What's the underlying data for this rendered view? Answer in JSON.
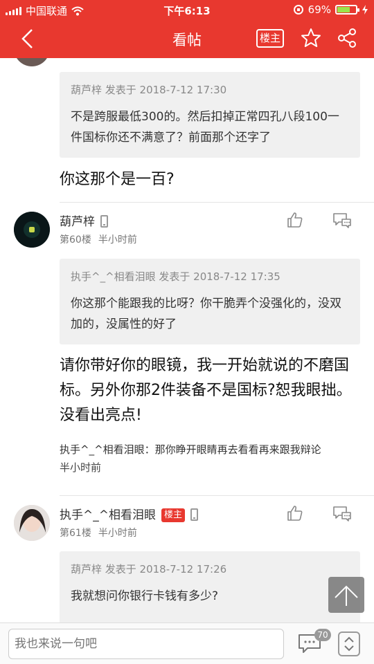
{
  "status_bar": {
    "carrier": "中国联通",
    "time": "下午6:13",
    "battery_percent": "69%",
    "battery_level": 0.69
  },
  "nav": {
    "title": "看帖",
    "owner_label": "楼主"
  },
  "posts": [
    {
      "quote_head": "葫芦梓 发表于 2018-7-12 17:30",
      "quote_body": "不是跨服最低300的。然后扣掉正常四孔八段100一件国标你还不满意了？前面那个还字了",
      "reply": "你这那个是一百?"
    },
    {
      "username": "葫芦梓",
      "floor": "第60楼",
      "time": "半小时前",
      "quote_head": "执手^_^相看泪眼 发表于 2018-7-12 17:35",
      "quote_body": "你这那个能跟我的比呀？你干脆弄个没强化的，没双加的，没属性的好了",
      "reply": "请你带好你的眼镜，我一开始就说的不磨国标。另外你那2件装备不是国标?恕我眼拙。没看出亮点!",
      "subreply_text": "执手^_^相看泪眼：那你睁开眼睛再去看看再来跟我辩论",
      "subreply_time": "半小时前"
    },
    {
      "username": "执手^_^相看泪眼",
      "owner_label": "楼主",
      "floor": "第61楼",
      "time": "半小时前",
      "quote_head": "葫芦梓 发表于 2018-7-12 17:26",
      "quote_body": "我就想问你银行卡钱有多少?"
    }
  ],
  "bottom_bar": {
    "input_placeholder": "我也来说一句吧",
    "comment_count": "70"
  }
}
